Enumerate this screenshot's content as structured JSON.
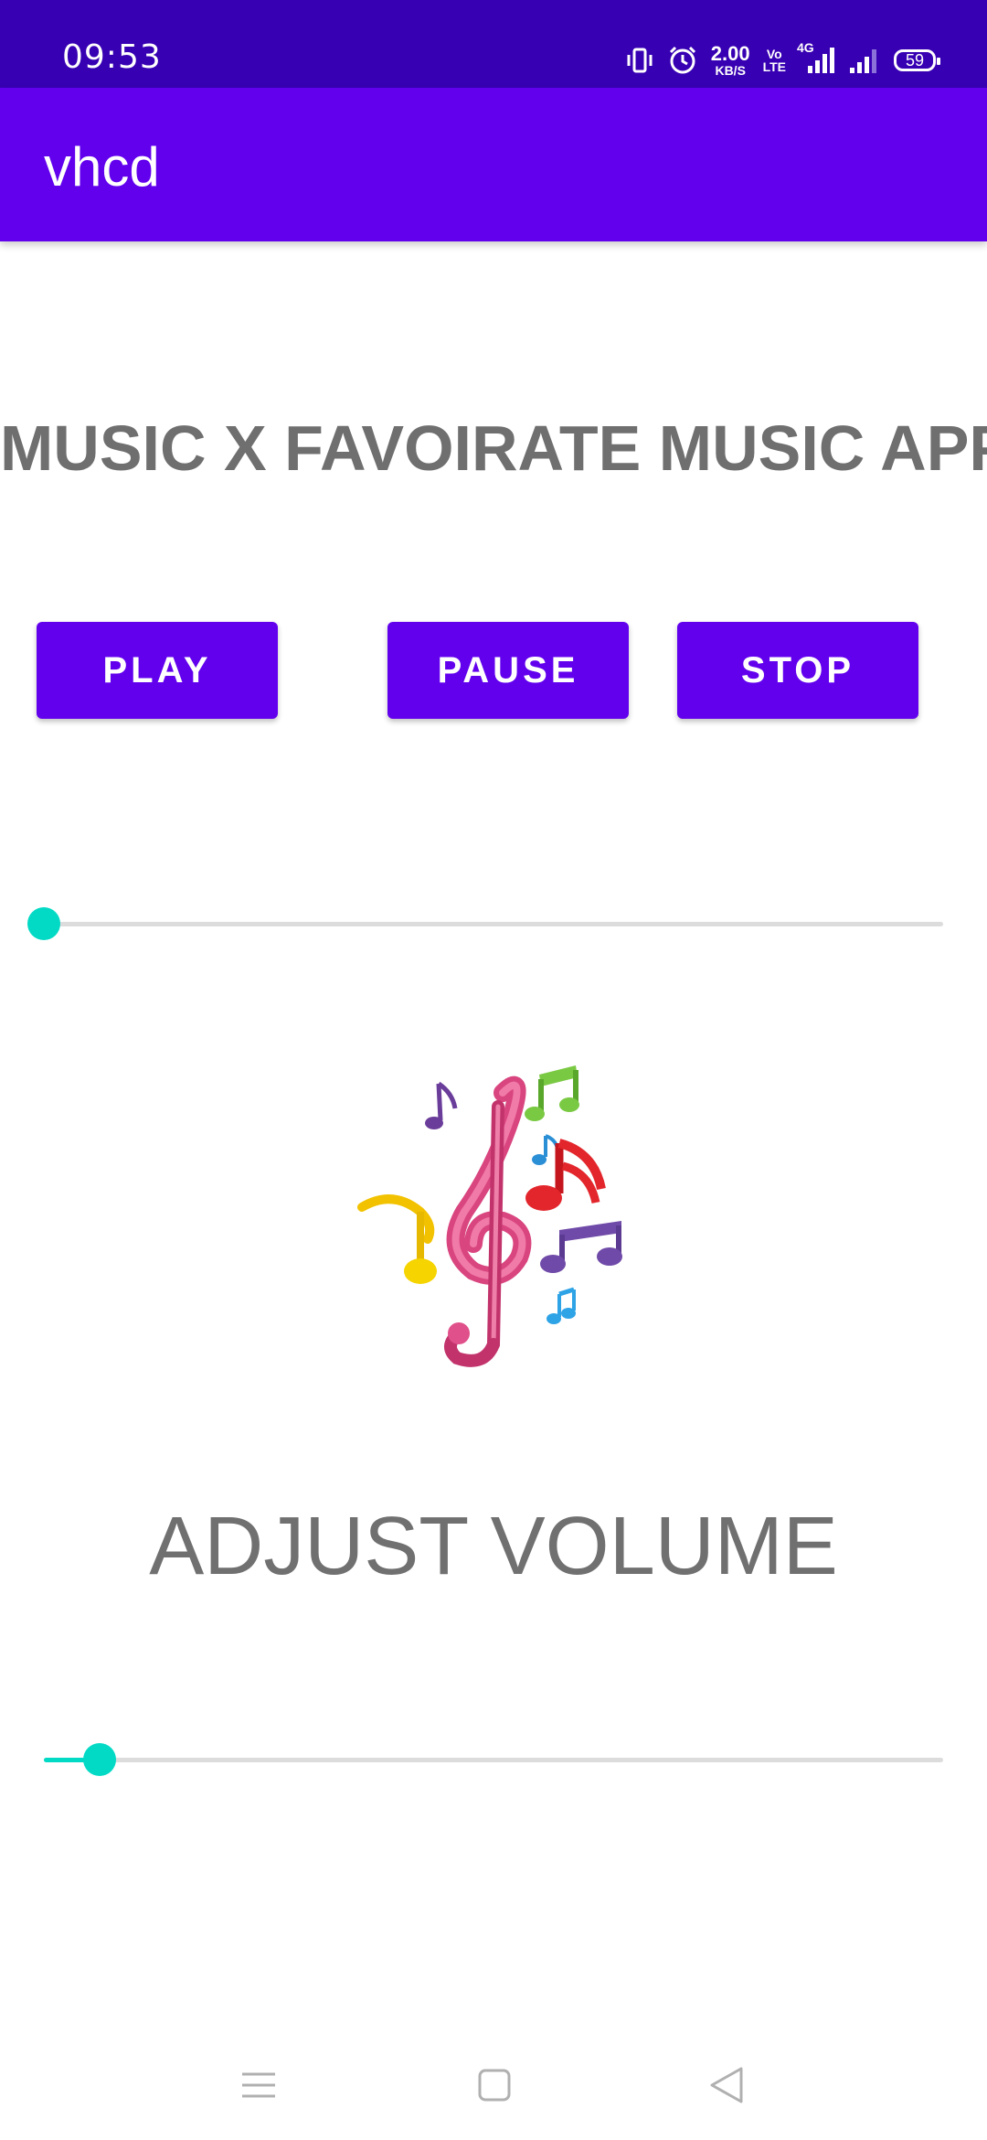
{
  "status_bar": {
    "time": "09:53",
    "net_speed_value": "2.00",
    "net_speed_unit": "KB/S",
    "volte_top": "Vo",
    "volte_bottom": "LTE",
    "network_type": "4G",
    "battery_level": "59",
    "icons": [
      "vibrate-icon",
      "alarm-icon",
      "signal-icon",
      "signal-icon",
      "battery-icon"
    ]
  },
  "app_bar": {
    "title": "vhcd"
  },
  "main": {
    "heading": "MUSIC X FAVOIRATE MUSIC APP",
    "buttons": {
      "play": "PLAY",
      "pause": "PAUSE",
      "stop": "STOP"
    },
    "seek_slider": {
      "value_fraction": 0.0
    },
    "volume_label": "ADJUST VOLUME",
    "volume_slider": {
      "value_fraction": 0.062
    }
  },
  "colors": {
    "status_bar": "#3700b3",
    "primary": "#6200ee",
    "accent": "#03dac5",
    "heading_text": "#6f6f6f"
  },
  "nav_bar": {
    "icons": [
      "menu-icon",
      "home-icon",
      "back-icon"
    ]
  }
}
